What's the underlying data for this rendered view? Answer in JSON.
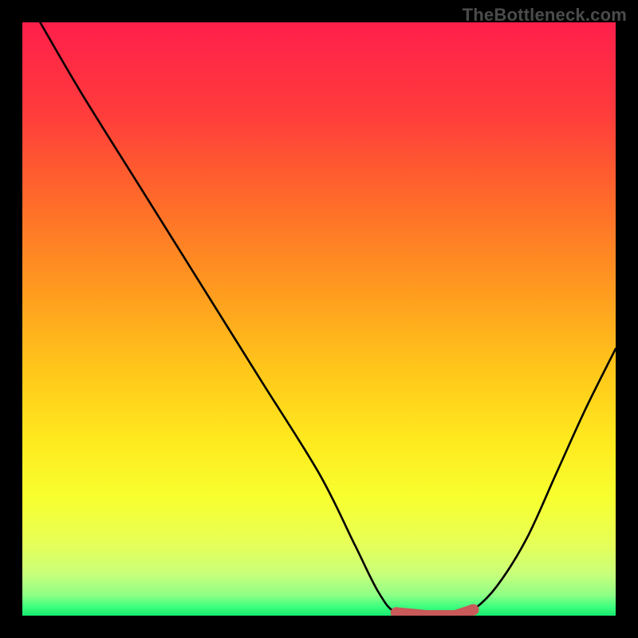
{
  "watermark": "TheBottleneck.com",
  "chart_data": {
    "type": "line",
    "title": "",
    "xlabel": "",
    "ylabel": "",
    "xlim": [
      0,
      100
    ],
    "ylim": [
      0,
      100
    ],
    "grid": false,
    "curve": {
      "description": "Bottleneck curve: starts high at left, drops to zero around x≈62–75, rises again to ~45 at x=100",
      "points": [
        {
          "x": 3,
          "y": 100
        },
        {
          "x": 10,
          "y": 88
        },
        {
          "x": 20,
          "y": 72
        },
        {
          "x": 30,
          "y": 56
        },
        {
          "x": 40,
          "y": 40
        },
        {
          "x": 50,
          "y": 24
        },
        {
          "x": 56,
          "y": 12
        },
        {
          "x": 60,
          "y": 4
        },
        {
          "x": 63,
          "y": 0.5
        },
        {
          "x": 68,
          "y": 0
        },
        {
          "x": 73,
          "y": 0
        },
        {
          "x": 76,
          "y": 1
        },
        {
          "x": 80,
          "y": 5
        },
        {
          "x": 85,
          "y": 13
        },
        {
          "x": 90,
          "y": 24
        },
        {
          "x": 95,
          "y": 35
        },
        {
          "x": 100,
          "y": 45
        }
      ],
      "optimal_range_x": [
        62,
        76
      ]
    },
    "gradient_stops": [
      {
        "offset": 0.0,
        "color": "#ff1f4b"
      },
      {
        "offset": 0.15,
        "color": "#ff3b3c"
      },
      {
        "offset": 0.3,
        "color": "#ff6a2a"
      },
      {
        "offset": 0.45,
        "color": "#ff9a1f"
      },
      {
        "offset": 0.58,
        "color": "#ffc51a"
      },
      {
        "offset": 0.7,
        "color": "#ffe81e"
      },
      {
        "offset": 0.8,
        "color": "#f8ff2e"
      },
      {
        "offset": 0.88,
        "color": "#e6ff58"
      },
      {
        "offset": 0.93,
        "color": "#c8ff7a"
      },
      {
        "offset": 0.965,
        "color": "#8fff86"
      },
      {
        "offset": 0.985,
        "color": "#3dff7e"
      },
      {
        "offset": 1.0,
        "color": "#17e86e"
      }
    ],
    "marker_color": "#c85a5a",
    "curve_color": "#000000"
  }
}
